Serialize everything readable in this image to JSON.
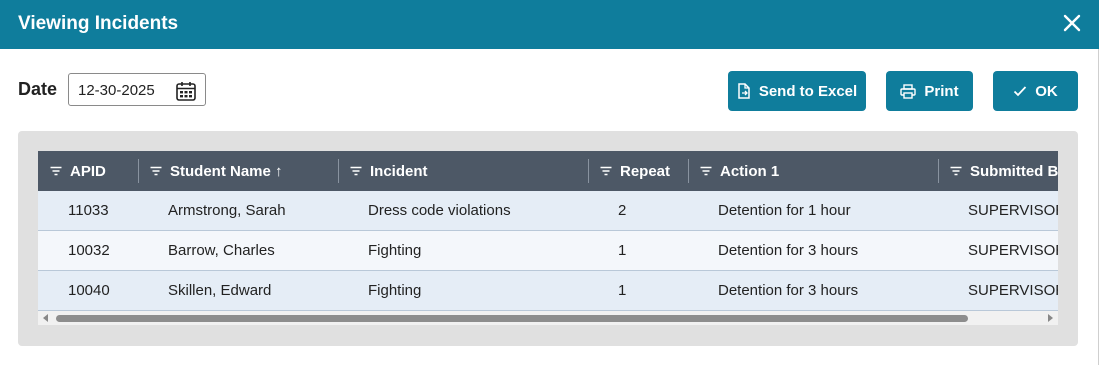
{
  "dialog": {
    "title": "Viewing Incidents",
    "close_icon": "close-icon"
  },
  "filters": {
    "date_label": "Date",
    "date_value": "12-30-2025",
    "calendar_icon": "calendar-icon"
  },
  "toolbar": {
    "excel_label": "Send to Excel",
    "print_label": "Print",
    "ok_label": "OK"
  },
  "grid": {
    "columns": [
      {
        "label": "APID"
      },
      {
        "label": "Student Name ↑"
      },
      {
        "label": "Incident"
      },
      {
        "label": "Repeat"
      },
      {
        "label": "Action 1"
      },
      {
        "label": "Submitted By"
      }
    ],
    "rows": [
      [
        "11033",
        "Armstrong, Sarah",
        "Dress code violations",
        "2",
        "Detention for 1 hour",
        "SUPERVISOR"
      ],
      [
        "10032",
        "Barrow, Charles",
        "Fighting",
        "1",
        "Detention for 3 hours",
        "SUPERVISOR"
      ],
      [
        "10040",
        "Skillen, Edward",
        "Fighting",
        "1",
        "Detention for 3 hours",
        "SUPERVISOR"
      ]
    ]
  },
  "colors": {
    "header_bar": "#0f7d9c",
    "grid_header": "#4d5866",
    "row_alt": "#e5edf6"
  }
}
